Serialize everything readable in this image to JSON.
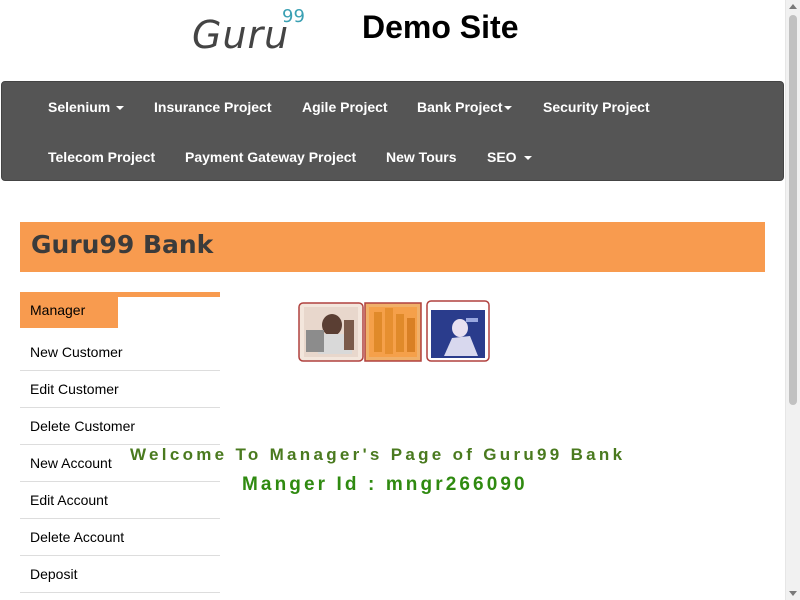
{
  "header": {
    "logo_text": "Guru",
    "logo_superscript": "99",
    "site_title": "Demo Site"
  },
  "navbar": {
    "row1": [
      {
        "label": "Selenium",
        "dropdown": true
      },
      {
        "label": "Insurance Project",
        "dropdown": false
      },
      {
        "label": "Agile Project",
        "dropdown": false
      },
      {
        "label": "Bank Project",
        "dropdown": true
      },
      {
        "label": "Security Project",
        "dropdown": false
      }
    ],
    "row2": [
      {
        "label": "Telecom Project",
        "dropdown": false
      },
      {
        "label": "Payment Gateway Project",
        "dropdown": false
      },
      {
        "label": "New Tours",
        "dropdown": false
      },
      {
        "label": "SEO",
        "dropdown": true
      }
    ]
  },
  "bank": {
    "title": "Guru99 Bank"
  },
  "menu": {
    "items": [
      {
        "label": "Manager",
        "active": true
      },
      {
        "label": "New Customer"
      },
      {
        "label": "Edit Customer"
      },
      {
        "label": "Delete Customer"
      },
      {
        "label": "New Account"
      },
      {
        "label": "Edit Account"
      },
      {
        "label": "Delete Account"
      },
      {
        "label": "Deposit"
      }
    ]
  },
  "content": {
    "welcome": "Welcome To Manager's Page of Guru99 Bank",
    "manager_id": "Manger Id : mngr266090"
  },
  "colors": {
    "accent": "#f89b4f",
    "navbar": "#555555",
    "welcome_text": "#4a7a1f",
    "manager_id_text": "#2f8a10"
  },
  "icons": {
    "logo": "guru99-logo",
    "image1": "man-at-desk-photo",
    "image2": "coins-stack-photo",
    "image3": "person-thinking-photo"
  }
}
